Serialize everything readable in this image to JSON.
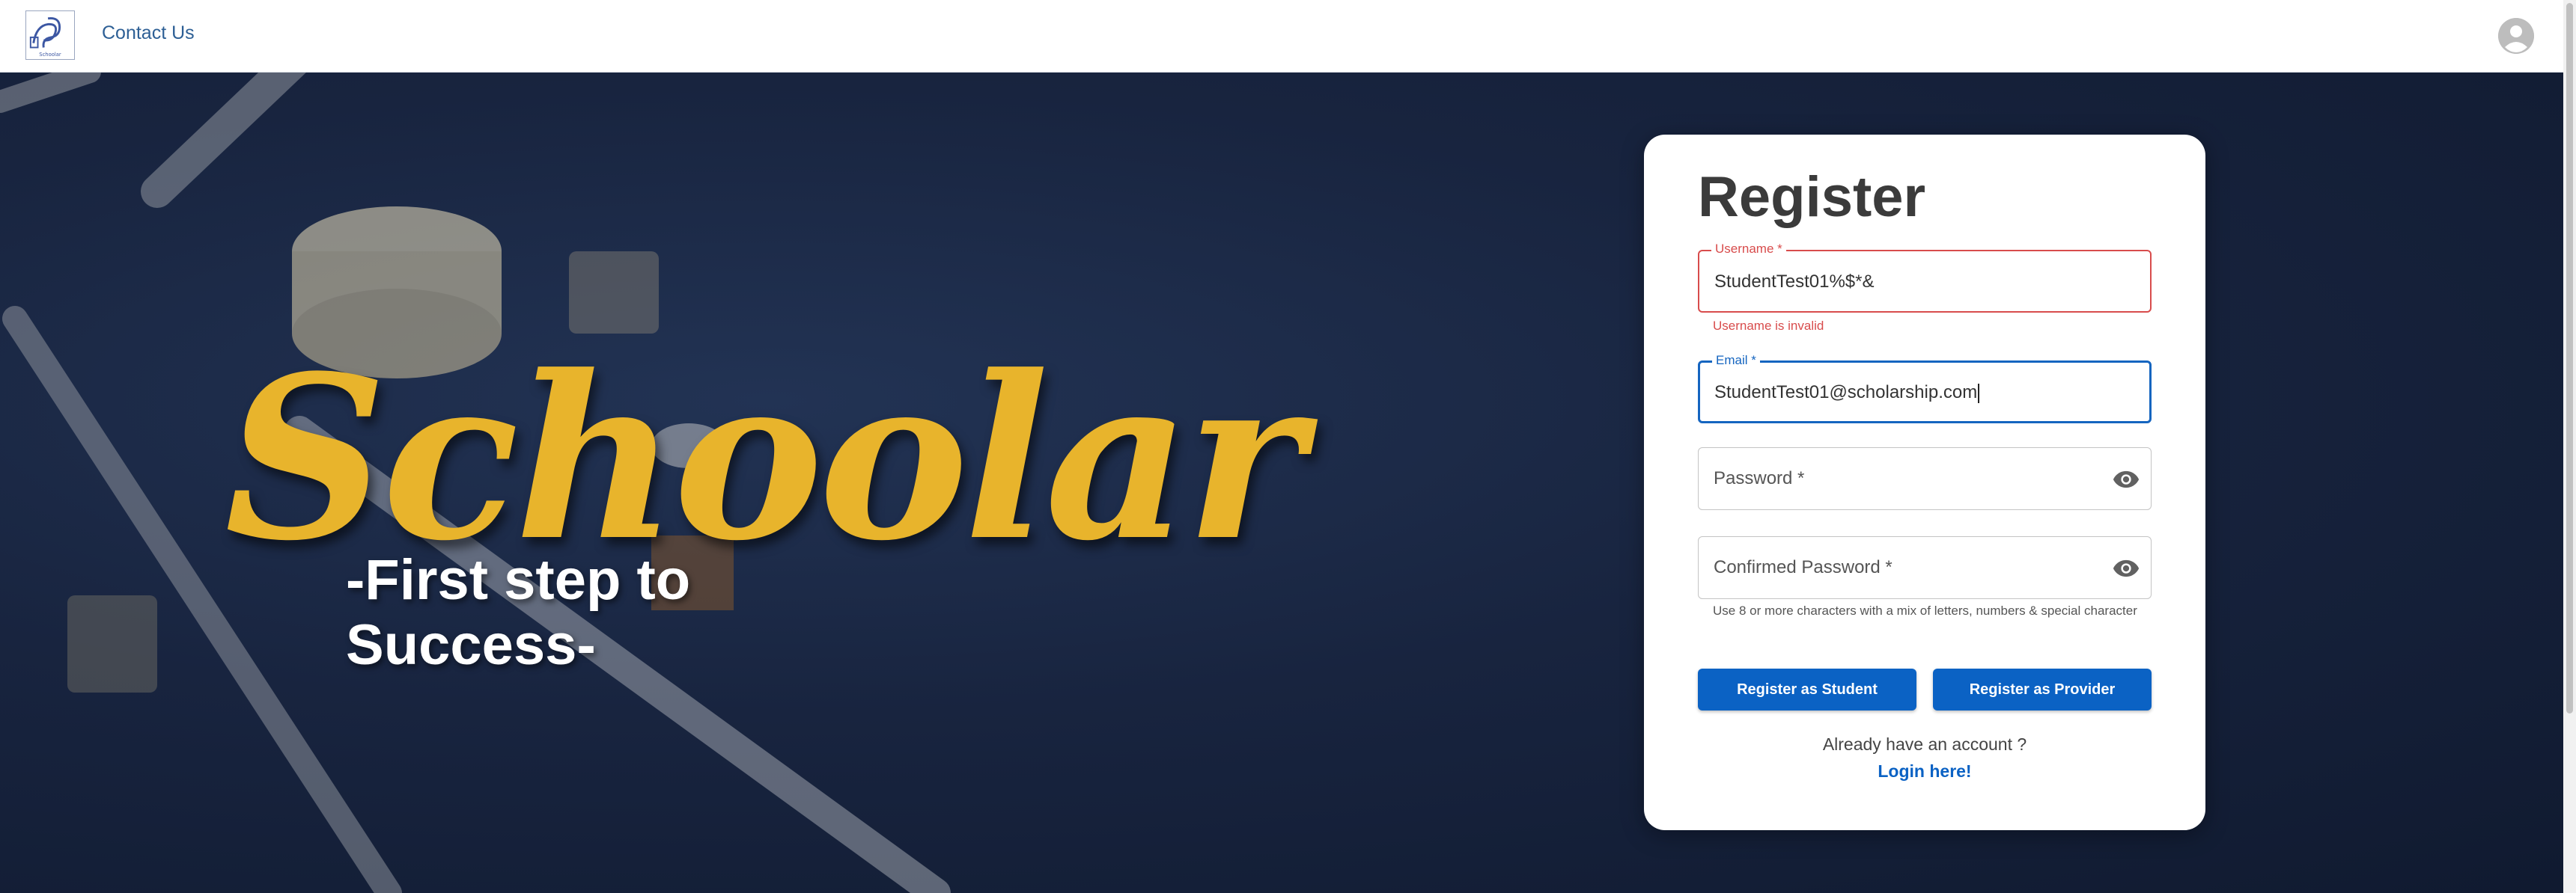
{
  "header": {
    "logo_text": "Schoolar",
    "contact_label": "Contact Us"
  },
  "hero": {
    "brand": "Schoolar",
    "tagline": "-First step to Success-"
  },
  "form": {
    "title": "Register",
    "username": {
      "label": "Username *",
      "value": "StudentTest01%$*&",
      "error": "Username is invalid"
    },
    "email": {
      "label": "Email *",
      "value": "StudentTest01@scholarship.com"
    },
    "password": {
      "placeholder": "Password *"
    },
    "confirm_password": {
      "placeholder": "Confirmed Password *"
    },
    "hint": "Use 8 or more characters with a mix of letters, numbers & special character",
    "register_student_label": "Register as Student",
    "register_provider_label": "Register as Provider",
    "already_text": "Already have an account ?",
    "login_label": "Login here!"
  },
  "colors": {
    "accent": "#0b62c4",
    "error": "#d84c4c",
    "brand_gold": "#e8b42c",
    "hero_bg": "#18243f"
  },
  "icons": {
    "logo": "schoolar-logo",
    "avatar": "account-circle-icon",
    "password_toggle": "eye-icon"
  }
}
